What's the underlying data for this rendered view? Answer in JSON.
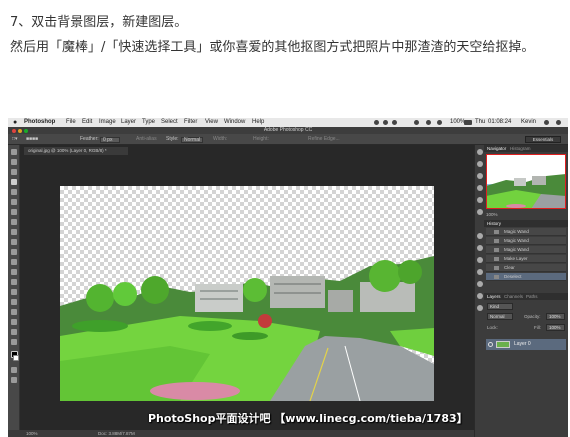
{
  "caption": {
    "step": "7、双击背景图层，新建图层。",
    "instruction": "然后用「魔棒」/「快速选择工具」或你喜爱的其他抠图方式把照片中那渣渣的天空给抠掉。"
  },
  "macbar": {
    "apple": "",
    "menus": [
      "Photoshop",
      "File",
      "Edit",
      "Image",
      "Layer",
      "Type",
      "Select",
      "Filter",
      "View",
      "Window",
      "Help"
    ],
    "battery": "100%",
    "day": "Thu",
    "time": "01:08:24",
    "user": "Kevin"
  },
  "app": {
    "title": "Adobe Photoshop CC"
  },
  "options": {
    "feather_label": "Feather:",
    "feather_value": "0 px",
    "antialias": "Anti-alias",
    "style_label": "Style:",
    "style_value": "Normal",
    "width_label": "Width:",
    "height_label": "Height:",
    "refine": "Refine Edge...",
    "workspace": "Essentials"
  },
  "document": {
    "tab": "original.jpg @ 100% (Layer 0, RGB/8) *",
    "zoom": "100%",
    "doc_size": "Doc: 3.88M/7.87M"
  },
  "watermark": "PhotoShop平面设计吧 【www.linecg.com/tieba/1783】",
  "panels": {
    "nav_tabs": [
      "Navigator",
      "Histogram"
    ],
    "zoom": "100%",
    "history_tab": "History",
    "history_items": [
      "Magic Wand",
      "Magic Wand",
      "Magic Wand",
      "Make Layer",
      "Clear",
      "Deselect"
    ],
    "layer_tabs": [
      "Layers",
      "Channels",
      "Paths"
    ],
    "kind": "Kind",
    "blend_mode": "Normal",
    "opacity_label": "Opacity:",
    "opacity_value": "100%",
    "lock_label": "Lock:",
    "fill_label": "Fill:",
    "fill_value": "100%",
    "layer_name": "Layer 0"
  }
}
